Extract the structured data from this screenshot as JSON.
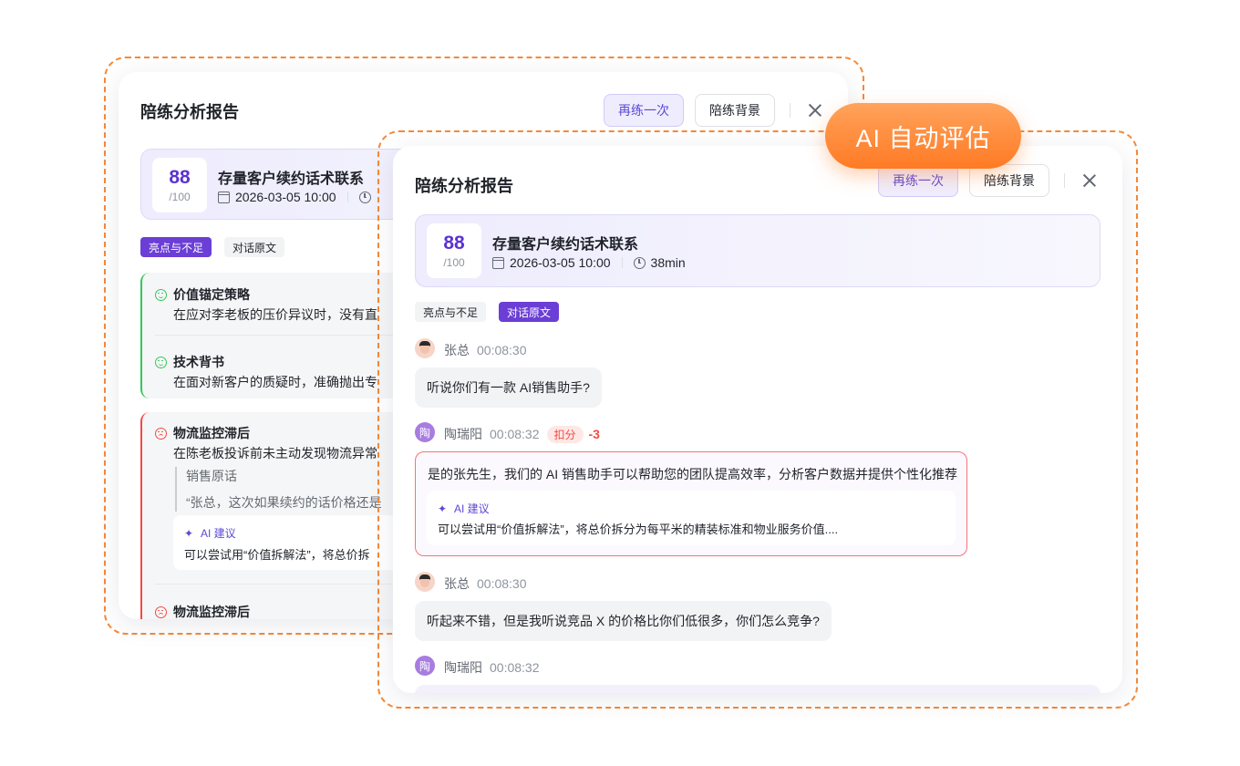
{
  "badge": {
    "label": "AI 自动评估"
  },
  "back": {
    "title": "陪练分析报告",
    "retry_label": "再练一次",
    "background_label": "陪练背景",
    "score": "88",
    "score_total": "/100",
    "session_title": "存量客户续约话术联系",
    "datetime": "2026-03-05 10:00",
    "tabs": [
      "亮点与不足",
      "对话原文"
    ],
    "highlights": [
      {
        "title": "价值锚定策略",
        "text": "在应对李老板的压价异议时，没有直"
      },
      {
        "title": "技术背书",
        "text": "在面对新客户的质疑时，准确抛出专"
      }
    ],
    "issues": [
      {
        "title": "物流监控滞后",
        "text": "在陈老板投诉前未主动发现物流异常",
        "quote_label": "销售原话",
        "quote_text": "“张总，这次如果续约的话价格还是",
        "ai_label": "AI 建议",
        "ai_text": "可以尝试用“价值拆解法”，将总价拆"
      },
      {
        "title": "物流监控滞后"
      }
    ]
  },
  "front": {
    "title": "陪练分析报告",
    "retry_label": "再练一次",
    "background_label": "陪练背景",
    "score": "88",
    "score_total": "/100",
    "session_title": "存量客户续约话术联系",
    "datetime": "2026-03-05 10:00",
    "duration": "38min",
    "tabs": [
      "亮点与不足",
      "对话原文"
    ],
    "messages": [
      {
        "speaker": "张总",
        "time": "00:08:30",
        "text": "听说你们有一款 AI销售助手?"
      },
      {
        "speaker": "陶瑞阳",
        "avatar_char": "陶",
        "time": "00:08:32",
        "deduct_label": "扣分",
        "deduct_value": "-3",
        "text": "是的张先生，我们的 AI 销售助手可以帮助您的团队提高效率，分析客户数据并提供个性化推荐",
        "ai_label": "AI 建议",
        "ai_text": "可以尝试用“价值拆解法”，将总价拆分为每平米的精装标准和物业服务价值...."
      },
      {
        "speaker": "张总",
        "time": "00:08:30",
        "text": "听起来不错，但是我听说竞品 X 的价格比你们低很多，你们怎么竞争?"
      },
      {
        "speaker": "陶瑞阳",
        "avatar_char": "陶",
        "time": "00:08:32"
      }
    ]
  },
  "colors": {
    "accent": "#6b3ed6",
    "orange": "#ff7a24",
    "good": "#34c759",
    "bad": "#f54a45"
  }
}
